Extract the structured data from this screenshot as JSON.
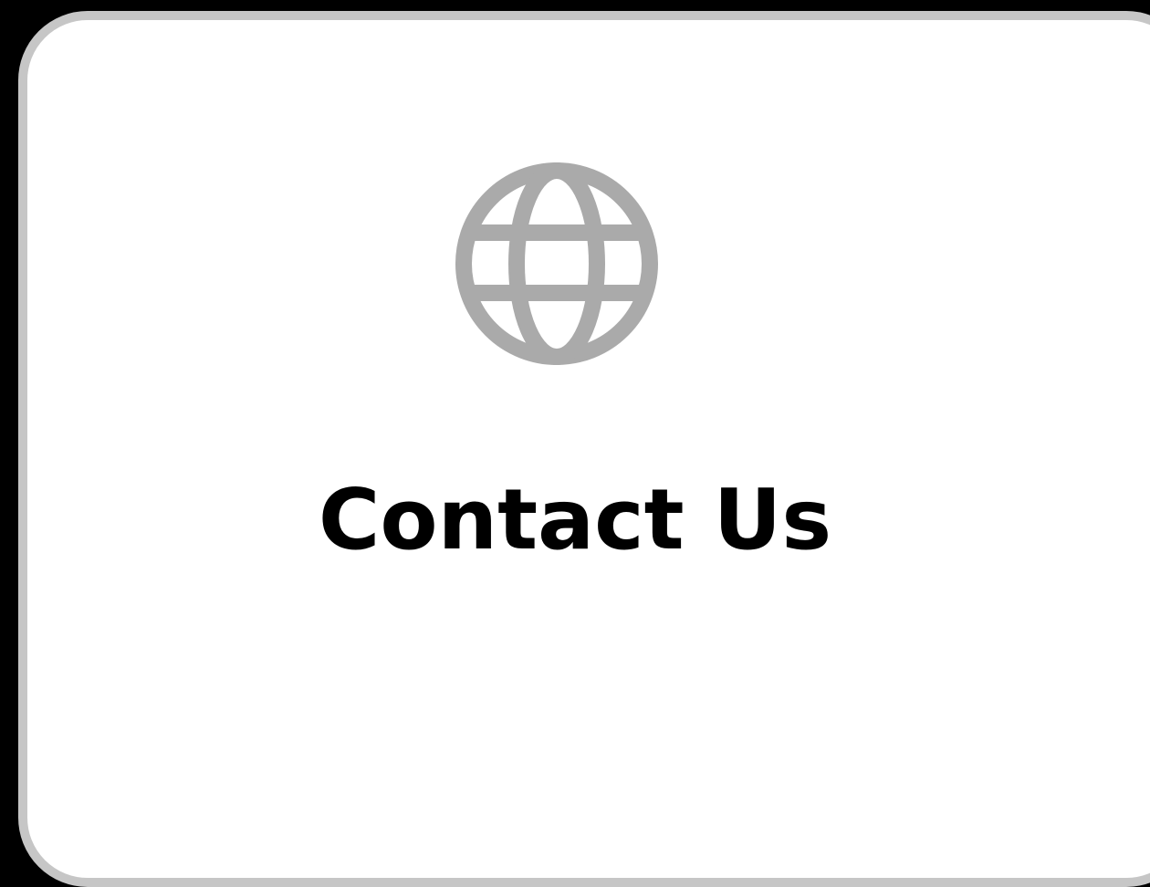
{
  "tile": {
    "icon": "globe-icon",
    "label": "Contact Us"
  },
  "colors": {
    "background": "#000000",
    "card": "#ffffff",
    "border": "#c6c6c6",
    "icon": "#aaaaaa",
    "text": "#000000"
  }
}
